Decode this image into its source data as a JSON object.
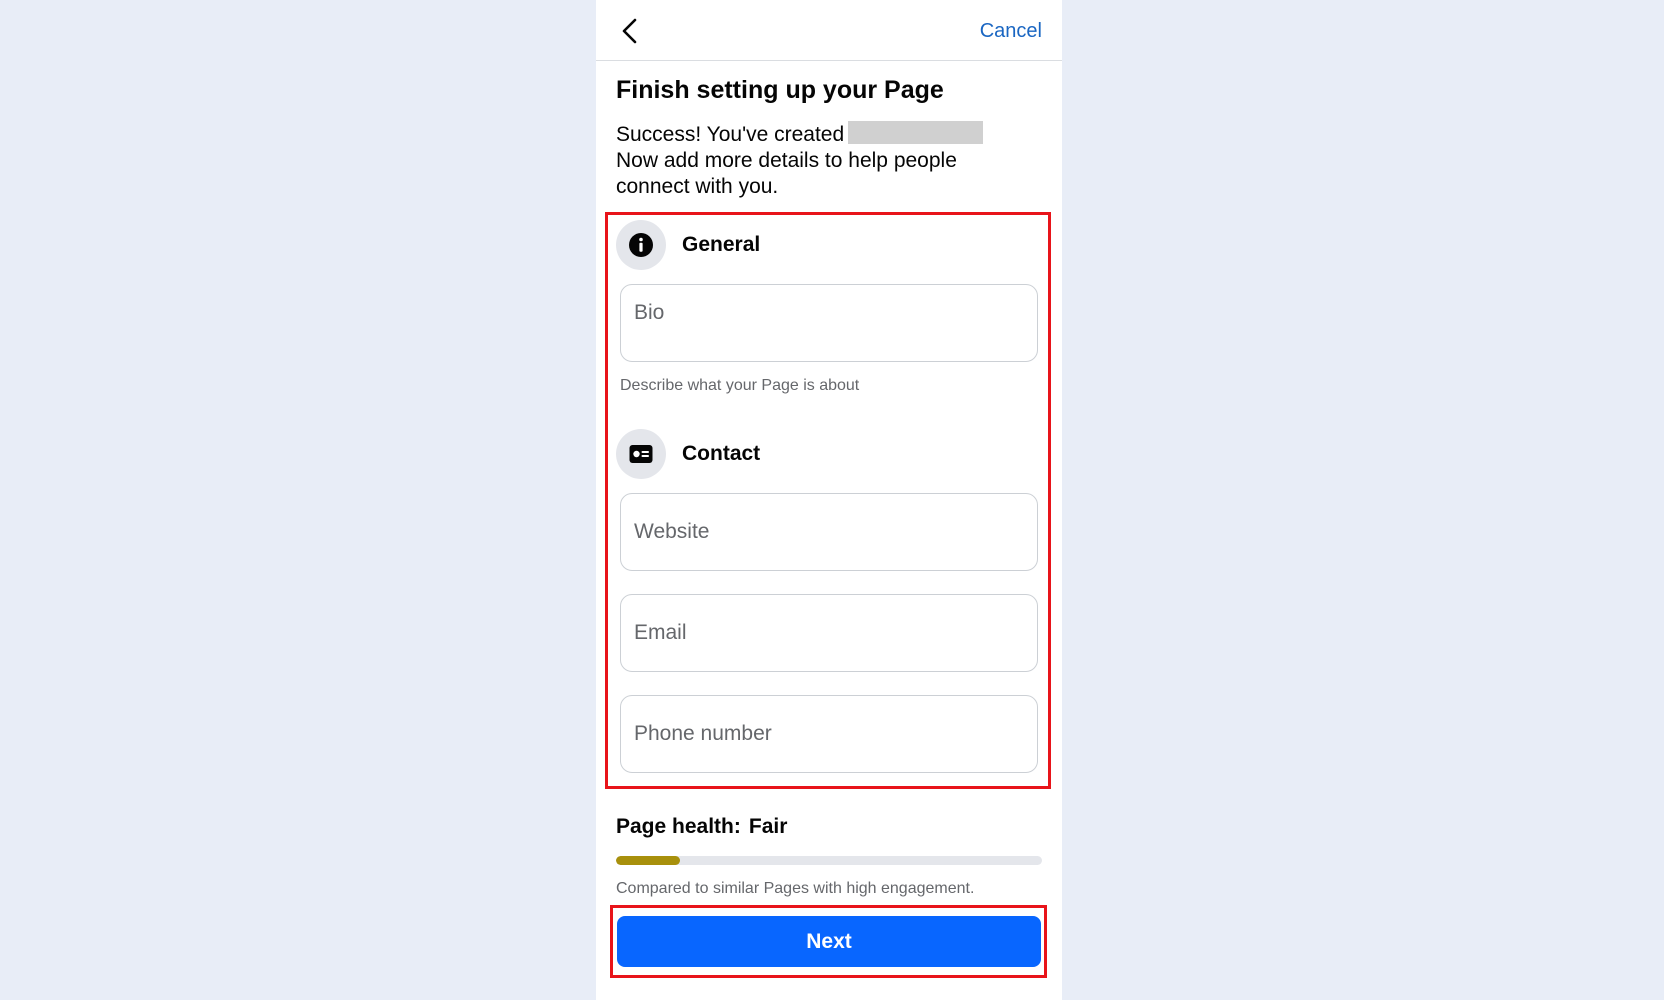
{
  "header": {
    "cancel_label": "Cancel"
  },
  "title": "Finish setting up your Page",
  "subtitle": {
    "line1": "Success! You've created",
    "line2": "Now add more details to help people connect with you."
  },
  "general": {
    "label": "General",
    "icon": "info-icon",
    "bio_placeholder": "Bio",
    "bio_helper": "Describe what your Page is about"
  },
  "contact": {
    "label": "Contact",
    "icon": "contact-card-icon",
    "website_placeholder": "Website",
    "email_placeholder": "Email",
    "phone_placeholder": "Phone number"
  },
  "health": {
    "label": "Page health:",
    "value": "Fair",
    "progress_fraction": 0.15,
    "bar_color": "#a8900c",
    "note": "Compared to similar Pages with high engagement."
  },
  "next_label": "Next",
  "colors": {
    "accent": "#0866ff",
    "highlight": "#e8141a",
    "link": "#1a66c2"
  }
}
